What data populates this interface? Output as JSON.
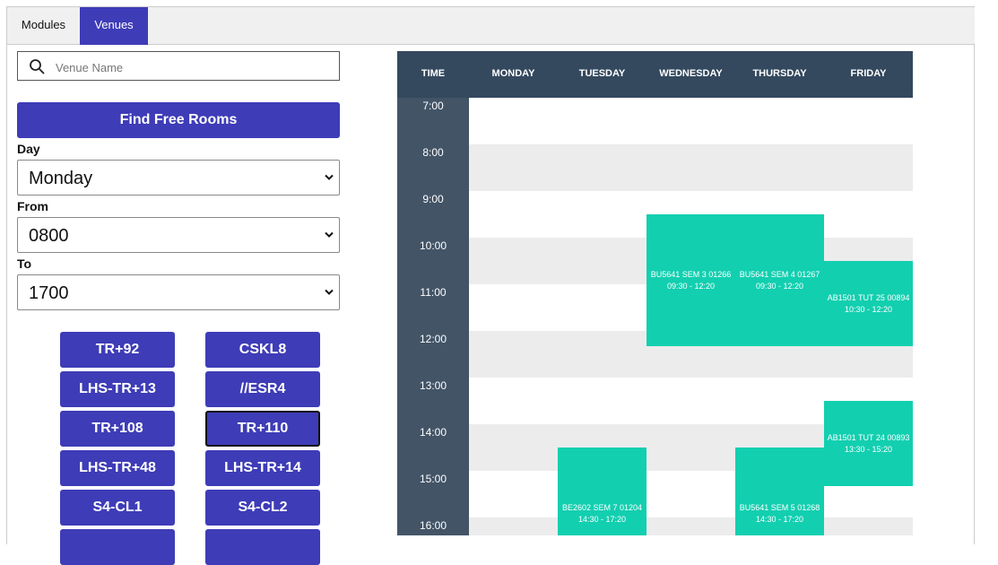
{
  "tabs": [
    {
      "label": "Modules",
      "active": false
    },
    {
      "label": "Venues",
      "active": true
    }
  ],
  "search": {
    "placeholder": "Venue Name",
    "value": ""
  },
  "find_button": "Find Free Rooms",
  "filters": {
    "day": {
      "label": "Day",
      "value": "Monday"
    },
    "from": {
      "label": "From",
      "value": "0800"
    },
    "to": {
      "label": "To",
      "value": "1700"
    }
  },
  "venues": [
    {
      "label": "TR+92",
      "selected": false
    },
    {
      "label": "CSKL8",
      "selected": false
    },
    {
      "label": "LHS-TR+13",
      "selected": false
    },
    {
      "label": "//ESR4",
      "selected": false
    },
    {
      "label": "TR+108",
      "selected": false
    },
    {
      "label": "TR+110",
      "selected": true
    },
    {
      "label": "LHS-TR+48",
      "selected": false
    },
    {
      "label": "LHS-TR+14",
      "selected": false
    },
    {
      "label": "S4-CL1",
      "selected": false
    },
    {
      "label": "S4-CL2",
      "selected": false
    },
    {
      "label": "",
      "selected": false
    },
    {
      "label": "",
      "selected": false
    }
  ],
  "timetable": {
    "headers": [
      "TIME",
      "MONDAY",
      "TUESDAY",
      "WEDNESDAY",
      "THURSDAY",
      "FRIDAY"
    ],
    "times": [
      "7:00",
      "8:00",
      "9:00",
      "10:00",
      "11:00",
      "12:00",
      "13:00",
      "14:00",
      "15:00",
      "16:00"
    ],
    "events": [
      {
        "day": 2,
        "start": "09:30",
        "end": "12:20",
        "title": "BU5641 SEM 3 01266",
        "time": "09:30 - 12:20"
      },
      {
        "day": 3,
        "start": "09:30",
        "end": "12:20",
        "title": "BU5641 SEM 4 01267",
        "time": "09:30 - 12:20"
      },
      {
        "day": 4,
        "start": "10:30",
        "end": "12:20",
        "title": "AB1501 TUT 25 00894",
        "time": "10:30 - 12:20"
      },
      {
        "day": 4,
        "start": "13:30",
        "end": "15:20",
        "title": "AB1501 TUT 24 00893",
        "time": "13:30 - 15:20"
      },
      {
        "day": 1,
        "start": "14:30",
        "end": "17:20",
        "title": "BE2602 SEM 7 01204",
        "time": "14:30 - 17:20"
      },
      {
        "day": 3,
        "start": "14:30",
        "end": "17:20",
        "title": "BU5641 SEM 5 01268",
        "time": "14:30 - 17:20"
      }
    ]
  },
  "colors": {
    "accent": "#3e3cb7",
    "header": "#34495e",
    "time_column": "#435467",
    "event": "#12cfb0",
    "row_alt": "#ececec"
  }
}
